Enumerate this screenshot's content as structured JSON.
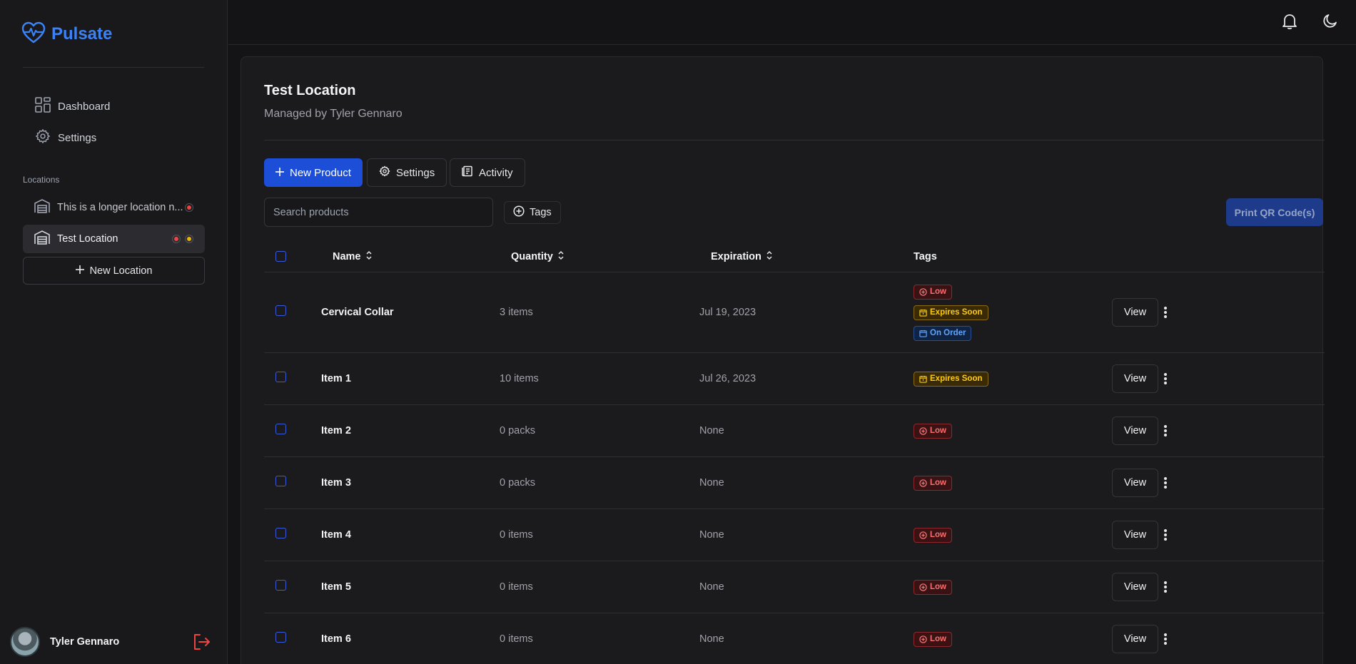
{
  "app": {
    "name": "Pulsate"
  },
  "sidebar": {
    "nav": [
      {
        "label": "Dashboard",
        "icon": "dashboard-icon"
      },
      {
        "label": "Settings",
        "icon": "gear-icon"
      }
    ],
    "locations_label": "Locations",
    "locations": [
      {
        "label": "This is a longer location n...",
        "status": [
          "red"
        ],
        "active": false
      },
      {
        "label": "Test Location",
        "status": [
          "red",
          "yellow"
        ],
        "active": true
      }
    ],
    "new_location_label": "New Location",
    "user": {
      "name": "Tyler Gennaro"
    }
  },
  "page": {
    "title": "Test Location",
    "subtitle": "Managed by Tyler Gennaro",
    "actions": {
      "new_product": "New Product",
      "settings": "Settings",
      "activity": "Activity"
    },
    "search": {
      "placeholder": "Search products",
      "value": ""
    },
    "tags_filter_label": "Tags",
    "print_label": "Print QR Code(s)"
  },
  "table": {
    "columns": {
      "name": "Name",
      "quantity": "Quantity",
      "expiration": "Expiration",
      "tags": "Tags"
    },
    "view_label": "View",
    "rows": [
      {
        "name": "Cervical Collar",
        "quantity": "3 items",
        "expiration": "Jul 19, 2023",
        "tags": [
          "Low",
          "Expires Soon",
          "On Order"
        ]
      },
      {
        "name": "Item 1",
        "quantity": "10 items",
        "expiration": "Jul 26, 2023",
        "tags": [
          "Expires Soon"
        ]
      },
      {
        "name": "Item 2",
        "quantity": "0 packs",
        "expiration": "None",
        "tags": [
          "Low"
        ]
      },
      {
        "name": "Item 3",
        "quantity": "0 packs",
        "expiration": "None",
        "tags": [
          "Low"
        ]
      },
      {
        "name": "Item 4",
        "quantity": "0 items",
        "expiration": "None",
        "tags": [
          "Low"
        ]
      },
      {
        "name": "Item 5",
        "quantity": "0 items",
        "expiration": "None",
        "tags": [
          "Low"
        ]
      },
      {
        "name": "Item 6",
        "quantity": "0 items",
        "expiration": "None",
        "tags": [
          "Low"
        ]
      }
    ]
  },
  "colors": {
    "accent": "#3b82f6",
    "primary_button": "#1d4ed8",
    "status_red": "#ef4444",
    "status_yellow": "#eab308",
    "logout": "#ef4444"
  }
}
